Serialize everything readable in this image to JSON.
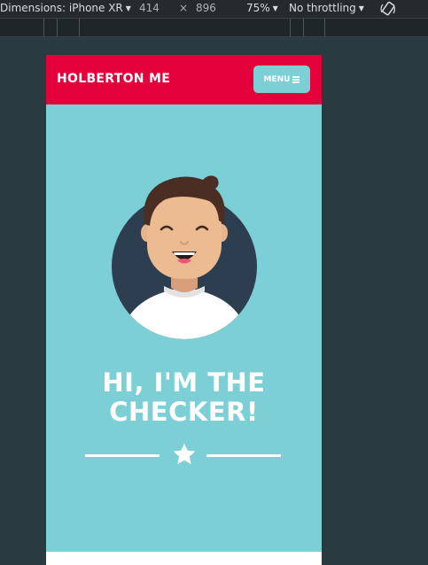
{
  "devtools": {
    "device_label": "Dimensions: iPhone XR",
    "width": "414",
    "times": "×",
    "height": "896",
    "zoom": "75%",
    "throttle": "No throttling"
  },
  "site": {
    "brand": "HOLBERTON ME",
    "menu_label": "MENU",
    "headline_line1": "HI, I'M THE",
    "headline_line2": "CHECKER!"
  },
  "colors": {
    "nav": "#e4003b",
    "hero": "#7ccfd4"
  },
  "icons": {
    "menu": "hamburger-icon",
    "divider": "star-icon",
    "rotate": "rotate-icon"
  }
}
